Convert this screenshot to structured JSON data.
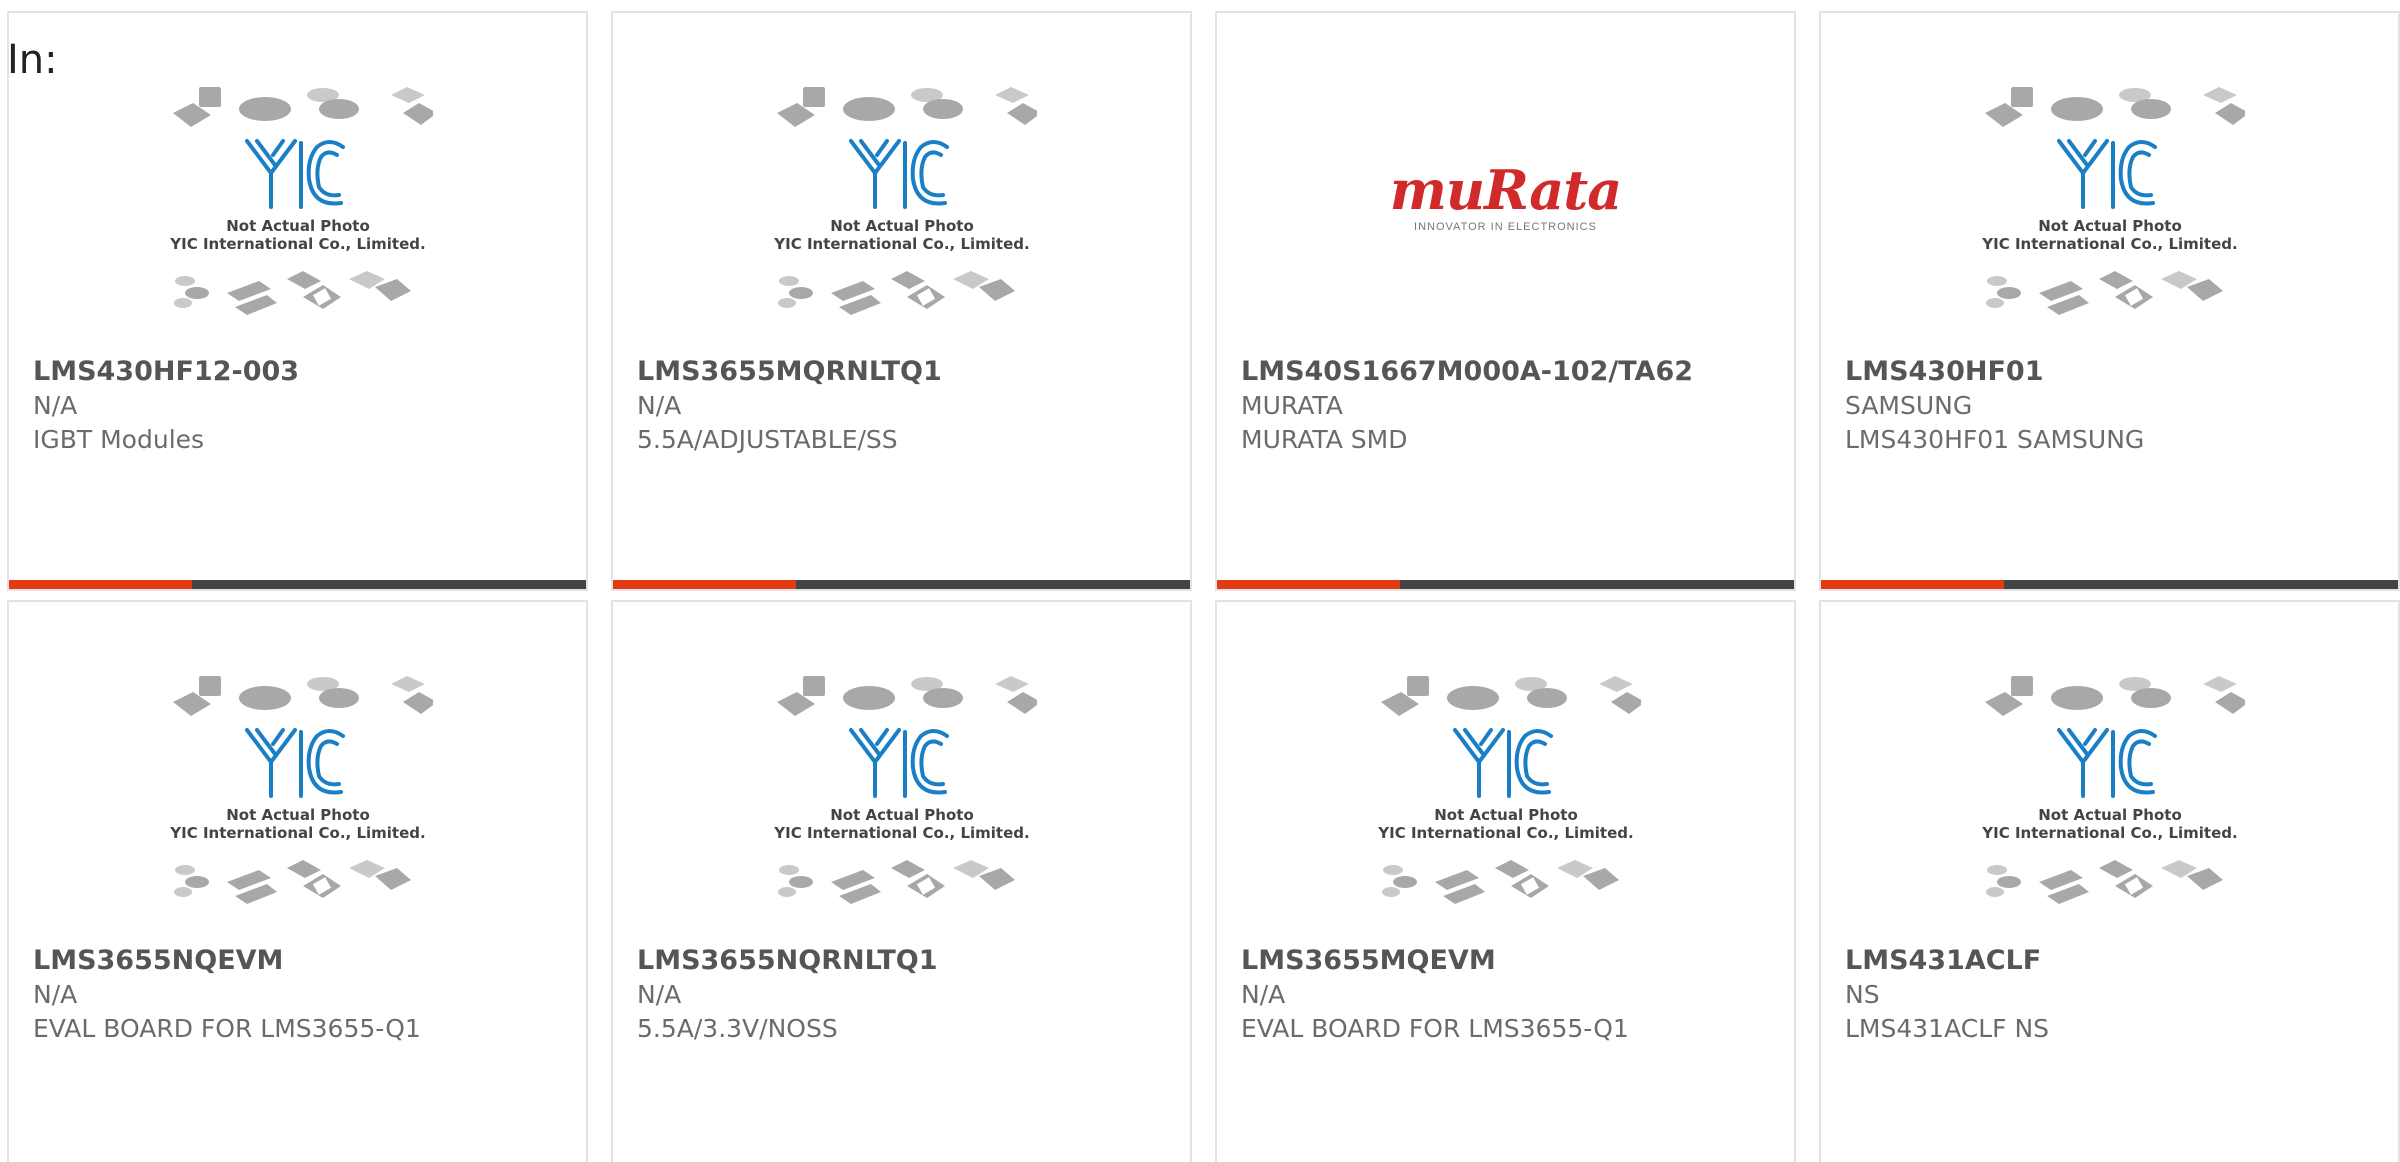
{
  "header": {
    "in_label": "In:"
  },
  "placeholder": {
    "line1": "Not Actual Photo",
    "line2": "YIC International Co., Limited."
  },
  "murata_logo": {
    "word": "muRata",
    "tagline": "INNOVATOR IN ELECTRONICS"
  },
  "colors": {
    "accent": "#e23b13",
    "bar": "#444444",
    "logo_blue": "#1a7fc4",
    "murata_red": "#d12a2a"
  },
  "products": [
    {
      "part": "LMS430HF12-003",
      "maker": "N/A",
      "desc": "IGBT Modules",
      "image": "placeholder",
      "bar": true
    },
    {
      "part": "LMS3655MQRNLTQ1",
      "maker": "N/A",
      "desc": "5.5A/ADJUSTABLE/SS",
      "image": "placeholder",
      "bar": true
    },
    {
      "part": "LMS40S1667M000A-102/TA62",
      "maker": "MURATA",
      "desc": "MURATA SMD",
      "image": "murata-logo",
      "bar": true
    },
    {
      "part": "LMS430HF01",
      "maker": "SAMSUNG",
      "desc": "LMS430HF01 SAMSUNG",
      "image": "placeholder",
      "bar": true
    },
    {
      "part": "LMS3655NQEVM",
      "maker": "N/A",
      "desc": "EVAL BOARD FOR LMS3655-Q1",
      "image": "placeholder",
      "bar": false
    },
    {
      "part": "LMS3655NQRNLTQ1",
      "maker": "N/A",
      "desc": "5.5A/3.3V/NOSS",
      "image": "placeholder",
      "bar": false
    },
    {
      "part": "LMS3655MQEVM",
      "maker": "N/A",
      "desc": "EVAL BOARD FOR LMS3655-Q1",
      "image": "placeholder",
      "bar": false
    },
    {
      "part": "LMS431ACLF",
      "maker": "NS",
      "desc": "LMS431ACLF NS",
      "image": "placeholder",
      "bar": false
    }
  ]
}
